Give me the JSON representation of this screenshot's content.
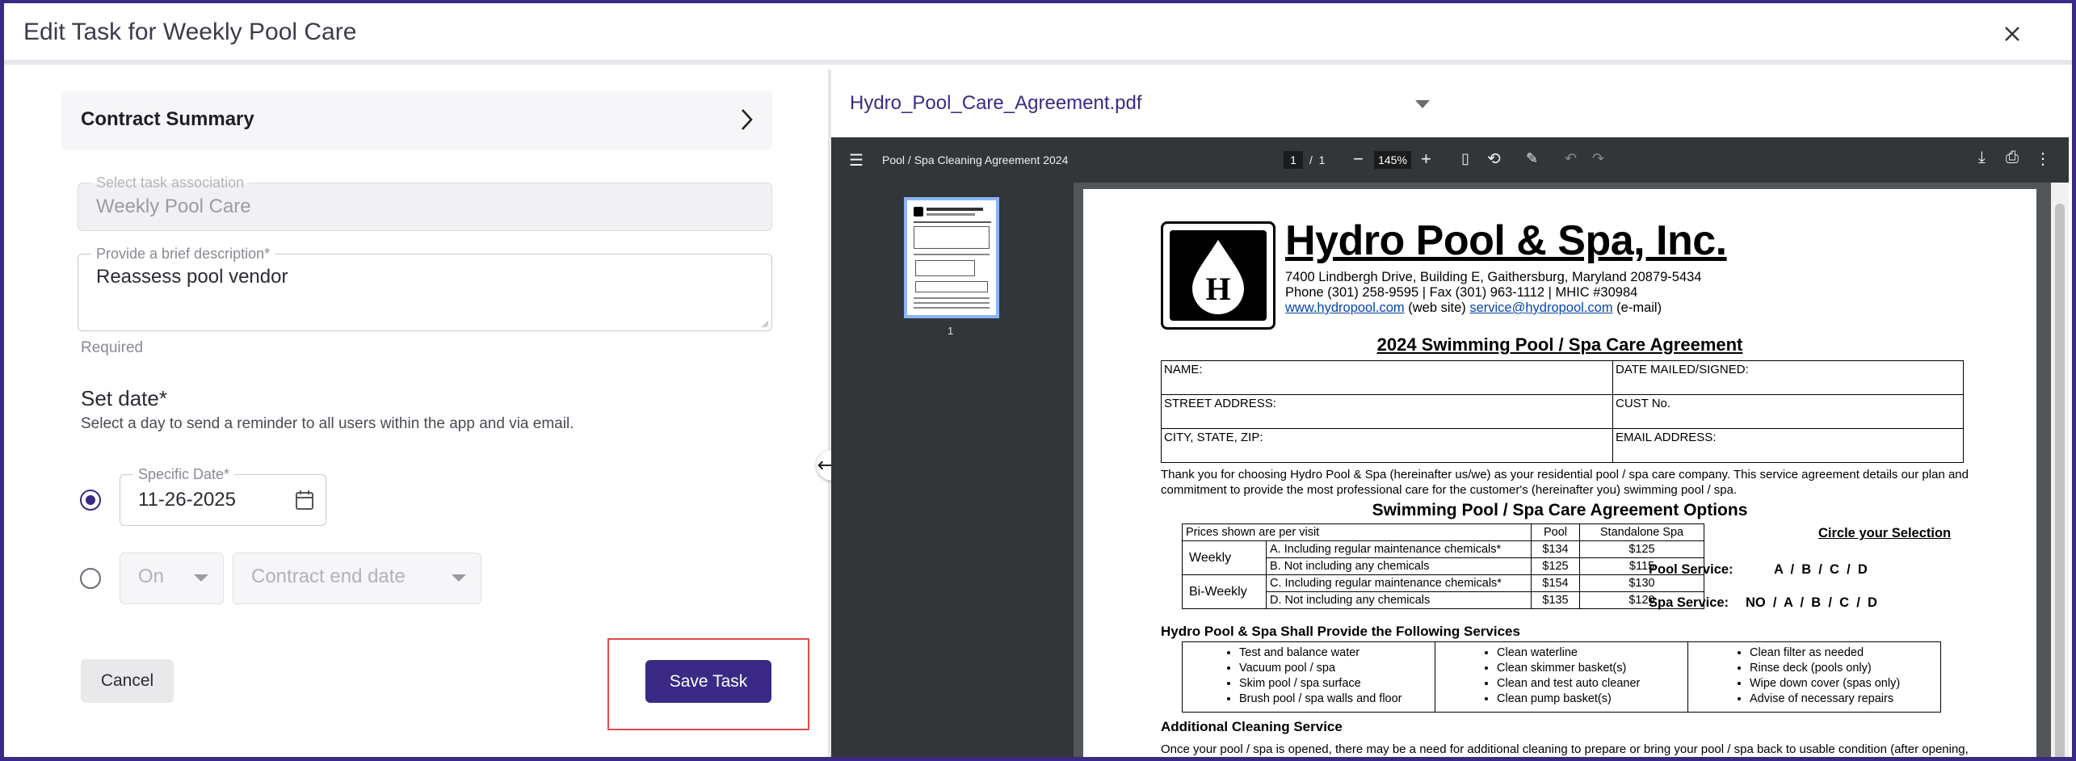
{
  "dialog": {
    "title": "Edit Task for Weekly Pool Care",
    "close_icon": "close-icon"
  },
  "form": {
    "contract_summary": "Contract Summary",
    "task_association": {
      "label": "Select task association",
      "value": "Weekly Pool Care"
    },
    "description": {
      "label": "Provide a brief description*",
      "value": "Reassess pool vendor"
    },
    "required_hint": "Required",
    "set_date": {
      "title": "Set date*",
      "subtitle": "Select a day to send a reminder to all users within the app and via email.",
      "specific_label": "Specific Date*",
      "specific_value": "11-26-2025",
      "on_value": "On",
      "end_value": "Contract end date"
    },
    "cancel_label": "Cancel",
    "save_label": "Save Task"
  },
  "document": {
    "filename": "Hydro_Pool_Care_Agreement.pdf",
    "viewer": {
      "title": "Pool / Spa Cleaning Agreement 2024",
      "page_current": "1",
      "page_sep": "/",
      "page_total": "1",
      "zoom": "145%",
      "thumb_page": "1"
    },
    "pdf": {
      "logo_letter": "H",
      "company": "Hydro Pool & Spa, Inc.",
      "address1": "7400 Lindbergh Drive, Building E, Gaithersburg, Maryland 20879-5434",
      "address2": "Phone (301) 258-9595 | Fax (301) 963-1112 | MHIC #30984",
      "website": "www.hydropool.com",
      "website_note": " (web site) ",
      "email": "service@hydropool.com",
      "email_note": " (e-mail)",
      "agreement_title": "2024 Swimming Pool / Spa Care Agreement",
      "fields": {
        "name": "NAME:",
        "date_mailed": "DATE MAILED/SIGNED:",
        "street": "STREET ADDRESS:",
        "cust_no": "CUST No.",
        "city": "CITY, STATE, ZIP:",
        "email_addr": "EMAIL ADDRESS:"
      },
      "thanks": "Thank you for choosing Hydro Pool & Spa (hereinafter us/we) as your residential pool / spa care company. This service agreement details our plan and commitment to provide the most professional care for the customer's (hereinafter you) swimming pool / spa.",
      "options_title": "Swimming Pool / Spa Care Agreement Options",
      "price_table": {
        "header": [
          "Prices shown are per visit",
          "Pool",
          "Standalone Spa"
        ],
        "weekly": "Weekly",
        "biweekly": "Bi-Weekly",
        "rows": [
          {
            "option": "A. Including regular maintenance chemicals*",
            "pool": "$134",
            "spa": "$125"
          },
          {
            "option": "B. Not including any chemicals",
            "pool": "$125",
            "spa": "$115"
          },
          {
            "option": "C. Including regular maintenance chemicals*",
            "pool": "$154",
            "spa": "$130"
          },
          {
            "option": "D. Not including any chemicals",
            "pool": "$135",
            "spa": "$120"
          }
        ]
      },
      "circle_selection": "Circle your Selection",
      "pool_service": {
        "label": "Pool Service:",
        "choices": "A  /  B  /  C  /  D"
      },
      "spa_service": {
        "label": "Spa Service:",
        "choices": "NO  /  A  /  B  /  C  /  D"
      },
      "services_title": "Hydro Pool & Spa Shall Provide the Following Services",
      "services": [
        [
          "Test and balance water",
          "Vacuum pool / spa",
          "Skim pool / spa surface",
          "Brush pool / spa walls and floor"
        ],
        [
          "Clean waterline",
          "Clean skimmer basket(s)",
          "Clean and test auto cleaner",
          "Clean pump basket(s)"
        ],
        [
          "Clean filter as needed",
          "Rinse deck (pools only)",
          "Wipe down cover (spas only)",
          "Advise of necessary repairs"
        ]
      ],
      "additional_title": "Additional Cleaning Service",
      "additional_text": "Once your pool / spa is opened, there may be a need for additional cleaning to prepare or bring your pool / spa back to usable condition (after opening, following a storm or after heavy use, for example). Any additional cleaning visits / service will be billed separately."
    }
  }
}
